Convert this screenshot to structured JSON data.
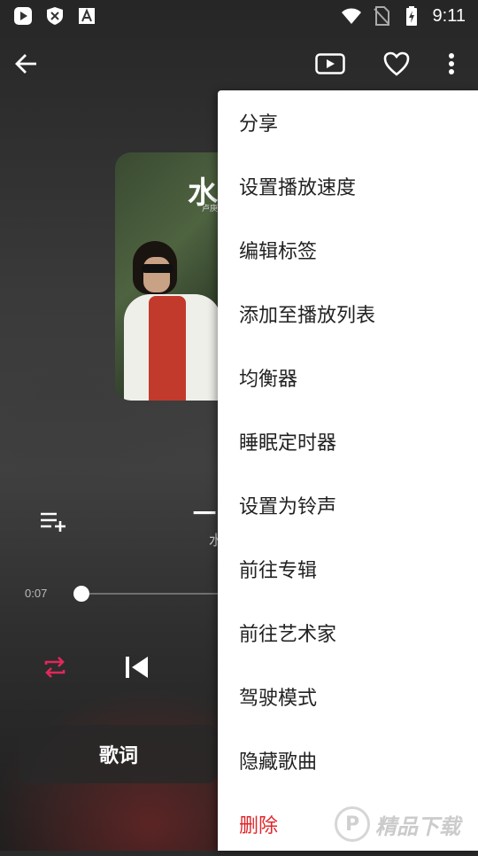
{
  "status_bar": {
    "time": "9:11",
    "left_icons": [
      "play-store-icon",
      "shield-icon",
      "text-a-icon"
    ],
    "right_icons": [
      "wifi-icon",
      "no-sim-icon",
      "battery-charging-icon"
    ]
  },
  "toolbar": {
    "icons": [
      "back-arrow-icon",
      "video-icon",
      "heart-icon",
      "more-vert-icon"
    ]
  },
  "album_art": {
    "title_fragment": "水",
    "subtitle_fragment": "卢庚"
  },
  "now_playing": {
    "title_fragment": "一",
    "artist_fragment": "水",
    "elapsed": "0:07",
    "progress": 0.02
  },
  "controls": {
    "lyrics_label": "歌词",
    "repeat_color": "#e0285a"
  },
  "menu": {
    "items": [
      {
        "label": "分享"
      },
      {
        "label": "设置播放速度"
      },
      {
        "label": "编辑标签"
      },
      {
        "label": "添加至播放列表"
      },
      {
        "label": "均衡器"
      },
      {
        "label": "睡眠定时器"
      },
      {
        "label": "设置为铃声"
      },
      {
        "label": "前往专辑"
      },
      {
        "label": "前往艺术家"
      },
      {
        "label": "驾驶模式"
      },
      {
        "label": "隐藏歌曲"
      },
      {
        "label": "删除"
      }
    ]
  },
  "watermark": {
    "logo_letter": "P",
    "text": "精品下载"
  }
}
